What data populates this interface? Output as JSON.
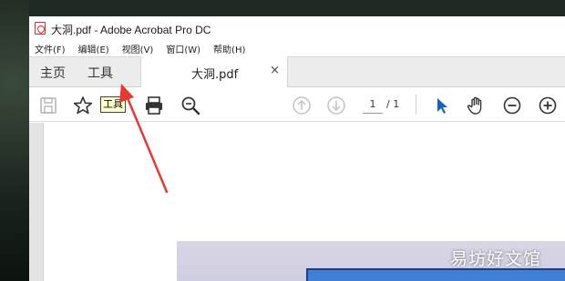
{
  "window": {
    "title": "大洞.pdf - Adobe Acrobat Pro DC"
  },
  "menubar": {
    "items": [
      "文件(F)",
      "编辑(E)",
      "视图(V)",
      "窗口(W)",
      "帮助(H)"
    ]
  },
  "tabs": {
    "home_label": "主页",
    "tools_label": "工具",
    "document_label": "大洞.pdf",
    "close_glyph": "×"
  },
  "toolbar": {
    "tools_chip_label": "工具",
    "current_page": "1",
    "total_pages": "/ 1",
    "icons": [
      "save-icon",
      "star-icon",
      "print-icon",
      "zoom-search-icon",
      "page-up-icon",
      "page-down-icon",
      "select-cursor-icon",
      "hand-tool-icon",
      "zoom-out-icon",
      "zoom-in-icon"
    ]
  },
  "overlay": {
    "watermark": "易坊好文馆",
    "arrow_color": "#e53935"
  },
  "colors": {
    "accent_blue": "#1565c0",
    "tab_bar_bg": "#ececec",
    "pdf_red": "#d32f2f"
  }
}
